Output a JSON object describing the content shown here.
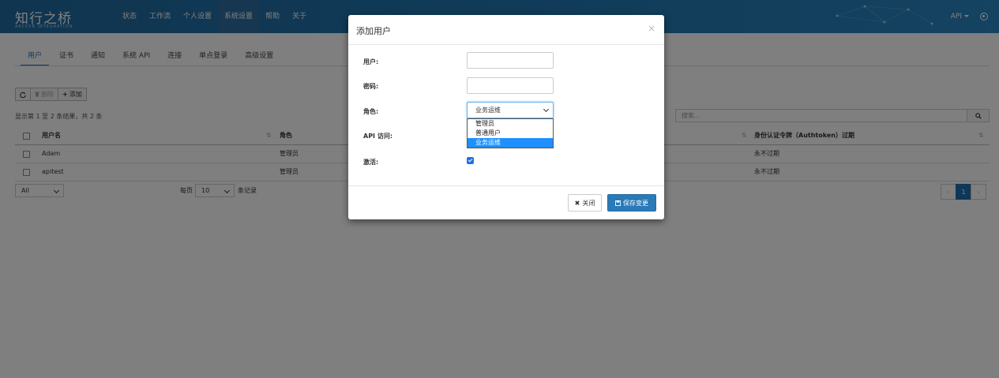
{
  "brand": {
    "title": "知行之桥",
    "subtitle": "ARCESB INTEGRATION"
  },
  "nav": {
    "items": [
      "状态",
      "工作流",
      "个人设置",
      "系统设置",
      "帮助",
      "关于"
    ],
    "active_index": 3,
    "api_label": "API"
  },
  "tabs": {
    "items": [
      "用户",
      "证书",
      "通知",
      "系统 API",
      "连接",
      "单点登录",
      "高级设置"
    ],
    "active_index": 0
  },
  "toolbar": {
    "delete_label": "删除",
    "add_label": "添加"
  },
  "table": {
    "info": "显示第 1 至 2 条结果，共 2 条",
    "search_placeholder": "搜索...",
    "columns": [
      "用户名",
      "角色",
      "身份认证令牌（Authtoken）过期"
    ],
    "rows": [
      {
        "username": "Adam",
        "role": "管理员",
        "expiry": "永不过期"
      },
      {
        "username": "apitest",
        "role": "管理员",
        "expiry": "永不过期"
      }
    ],
    "length_select": "All",
    "per_page_prefix": "每页",
    "per_page_value": "10",
    "per_page_suffix": "条记录",
    "current_page": "1",
    "prev_label": "‹",
    "next_label": "›"
  },
  "modal": {
    "title": "添加用户",
    "close_symbol": "×",
    "fields": {
      "user_label": "用户:",
      "password_label": "密码:",
      "role_label": "角色:",
      "api_label": "API 访问:",
      "active_label": "激活:"
    },
    "role_selected": "业务运维",
    "role_options": [
      "管理员",
      "普通用户",
      "业务运维"
    ],
    "active_checked": true,
    "close_button": "关闭",
    "save_button": "保存变更"
  },
  "colors": {
    "nav_bg": "#2277b2",
    "accent": "#1f6fb0",
    "save_btn": "#2a7ab8",
    "option_highlight": "#1e90ff"
  }
}
